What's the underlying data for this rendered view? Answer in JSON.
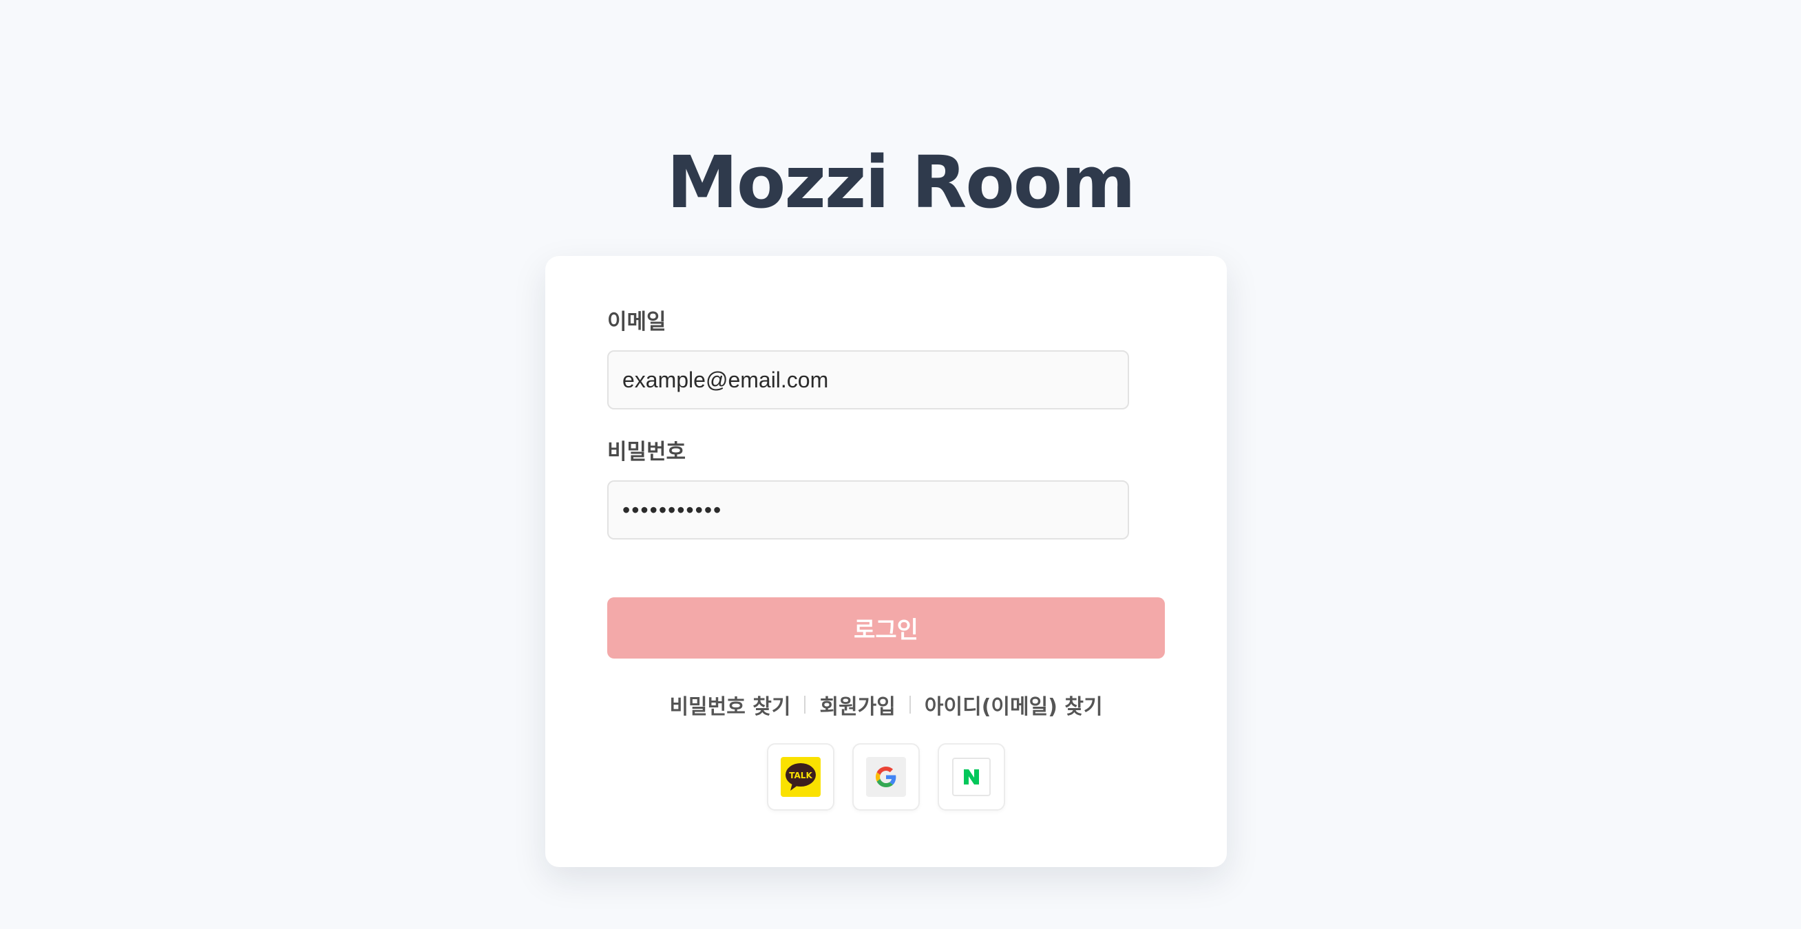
{
  "app": {
    "title": "Mozzi Room"
  },
  "login_form": {
    "email_label": "이메일",
    "email_value": "example@email.com",
    "password_label": "비밀번호",
    "password_value": "•••••••••••",
    "submit_label": "로그인"
  },
  "links": {
    "find_password": "비밀번호 찾기",
    "sign_up": "회원가입",
    "find_id": "아이디(이메일) 찾기"
  },
  "social_login": {
    "kakao_text": "TALK",
    "google_icon": "google-icon",
    "naver_icon": "naver-icon"
  },
  "colors": {
    "title": "#2f3a4c",
    "login_button": "#f3a9a9",
    "kakao": "#fae100",
    "naver": "#03c75a",
    "background": "#f7f9fc"
  }
}
